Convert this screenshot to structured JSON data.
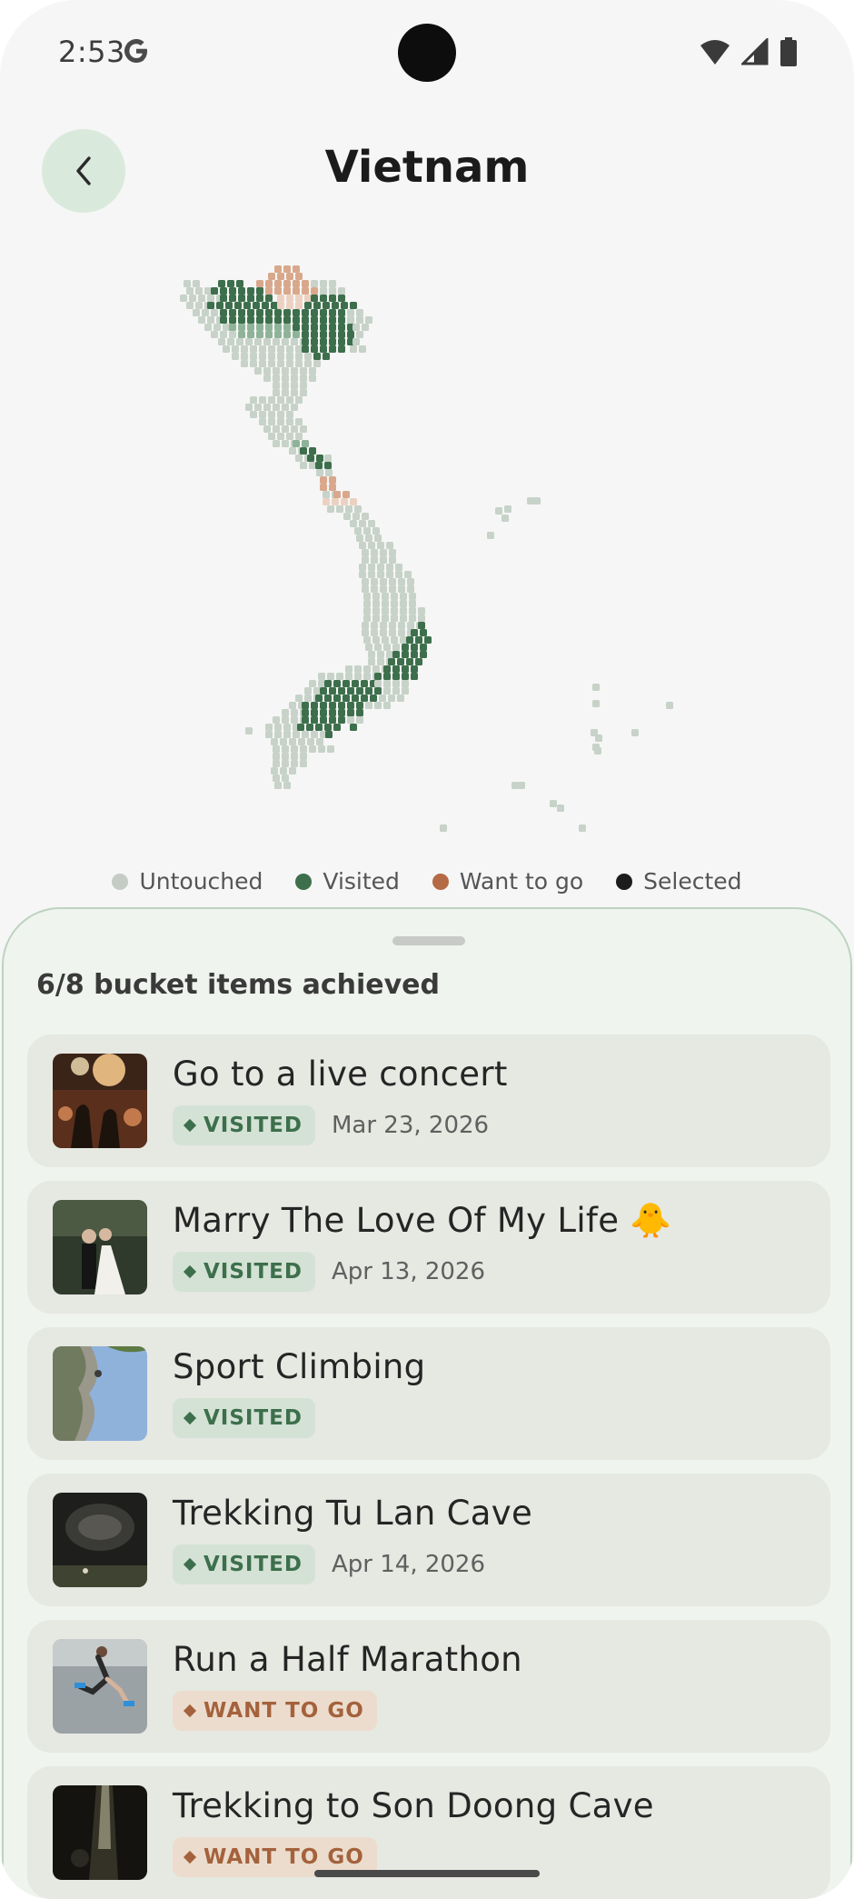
{
  "status_bar": {
    "time": "2:53"
  },
  "header": {
    "title": "Vietnam"
  },
  "colors": {
    "untouched": "#c7d2c8",
    "visited": "#3d6f4c",
    "want_to_go": "#b46a44",
    "selected": "#1c1c1c",
    "accent": "#d9eadc"
  },
  "legend": [
    {
      "label": "Untouched",
      "color": "#c4ccc5"
    },
    {
      "label": "Visited",
      "color": "#3d6f4c"
    },
    {
      "label": "Want to go",
      "color": "#b46a44"
    },
    {
      "label": "Selected",
      "color": "#1c1c1c"
    }
  ],
  "sheet": {
    "summary": "6/8 bucket items achieved",
    "items": [
      {
        "title": "Go to a live concert",
        "status": "VISITED",
        "status_type": "visited",
        "date": "Mar 23, 2026",
        "thumb": "concert"
      },
      {
        "title": "Marry The Love Of My Life 🐥",
        "status": "VISITED",
        "status_type": "visited",
        "date": "Apr 13, 2026",
        "thumb": "wedding"
      },
      {
        "title": "Sport Climbing",
        "status": "VISITED",
        "status_type": "visited",
        "date": "",
        "thumb": "climbing"
      },
      {
        "title": "Trekking Tu Lan Cave",
        "status": "VISITED",
        "status_type": "visited",
        "date": "Apr 14, 2026",
        "thumb": "cave"
      },
      {
        "title": "Run a Half Marathon",
        "status": "WANT TO GO",
        "status_type": "want",
        "date": "",
        "thumb": "running"
      },
      {
        "title": "Trekking to Son Doong Cave",
        "status": "WANT TO GO",
        "status_type": "want",
        "date": "",
        "thumb": "sondoong"
      }
    ]
  }
}
